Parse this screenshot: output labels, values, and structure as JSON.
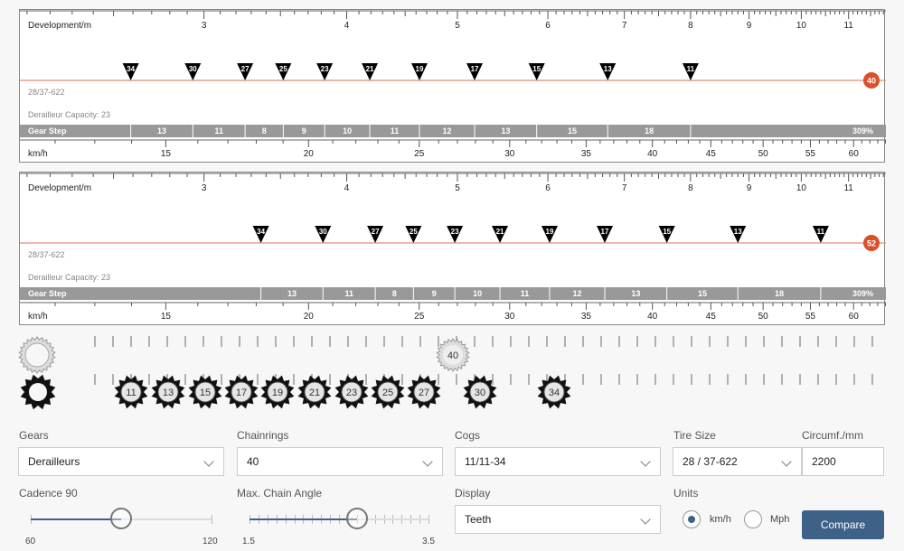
{
  "colors": {
    "accent": "#3e6188",
    "chainring_badge": "#d9512c",
    "chain_line": "#e9a08c",
    "gear_step_bar": "#999999",
    "marker": "#000000"
  },
  "chart_data": [
    {
      "type": "scale",
      "dev_axis_label": "Development/m",
      "dev_ticks": [
        3,
        4,
        5,
        6,
        7,
        8,
        9,
        10,
        11
      ],
      "dev_range": [
        2.07,
        11.86
      ],
      "dev_log_scale": true,
      "speed_axis_label": "km/h",
      "speed_ticks": [
        15,
        20,
        25,
        30,
        35,
        40,
        45,
        50,
        55,
        60
      ],
      "chainring": "40",
      "cogs": [
        "34",
        "30",
        "27",
        "25",
        "23",
        "21",
        "19",
        "17",
        "15",
        "13",
        "11"
      ],
      "tire_label": "28/37-622",
      "capacity_label": "Derailleur Capacity: 23",
      "gear_step_label": "Gear Step",
      "gear_steps": [
        "13",
        "11",
        "8",
        "9",
        "10",
        "11",
        "12",
        "13",
        "15",
        "18"
      ],
      "gear_range": "309%"
    },
    {
      "type": "scale",
      "dev_axis_label": "Development/m",
      "dev_ticks": [
        3,
        4,
        5,
        6,
        7,
        8,
        9,
        10,
        11
      ],
      "dev_range": [
        2.07,
        11.86
      ],
      "dev_log_scale": true,
      "speed_axis_label": "km/h",
      "speed_ticks": [
        15,
        20,
        25,
        30,
        35,
        40,
        45,
        50,
        55,
        60
      ],
      "chainring": "52",
      "cogs": [
        "34",
        "30",
        "27",
        "25",
        "23",
        "21",
        "19",
        "17",
        "15",
        "13",
        "11"
      ],
      "tire_label": "28/37-622",
      "capacity_label": "Derailleur Capacity: 23",
      "gear_step_label": "Gear Step",
      "gear_steps": [
        "13",
        "11",
        "8",
        "9",
        "10",
        "11",
        "12",
        "13",
        "15",
        "18"
      ],
      "gear_range": "309%"
    }
  ],
  "visual": {
    "chainring": "40",
    "cogs": [
      "11",
      "13",
      "15",
      "17",
      "19",
      "21",
      "23",
      "25",
      "27",
      "30",
      "34"
    ]
  },
  "form": {
    "gears": {
      "label": "Gears",
      "value": "Derailleurs"
    },
    "chainrings": {
      "label": "Chainrings",
      "value": "40"
    },
    "cogs": {
      "label": "Cogs",
      "value": "11/11-34"
    },
    "tire": {
      "label": "Tire Size",
      "value": "28 / 37-622"
    },
    "circumference": {
      "label": "Circumf./mm",
      "value": "2200"
    },
    "cadence": {
      "label": "Cadence 90",
      "min": "60",
      "max": "120",
      "value": 90
    },
    "chain_angle": {
      "label": "Max. Chain Angle",
      "min": "1.5",
      "max": "3.5",
      "value": 2.7
    },
    "display": {
      "label": "Display",
      "value": "Teeth"
    },
    "units": {
      "label": "Units",
      "options": [
        "km/h",
        "Mph"
      ],
      "selected": "km/h"
    },
    "compare_label": "Compare"
  }
}
